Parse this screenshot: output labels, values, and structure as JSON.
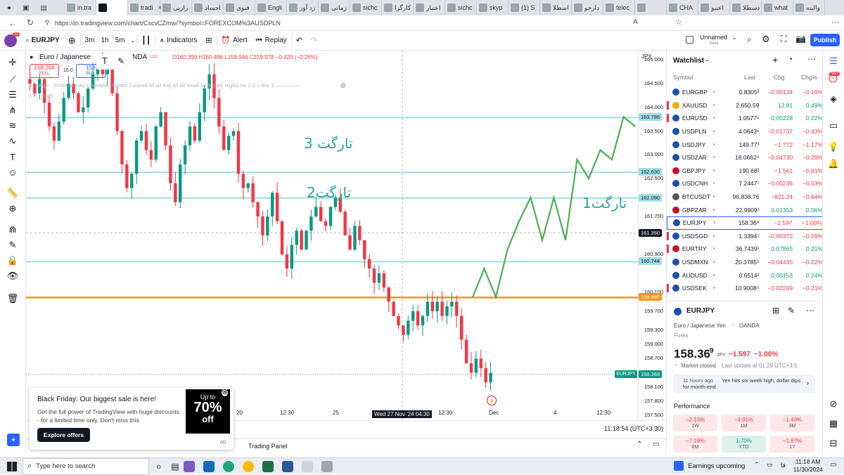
{
  "browser": {
    "tabs": [
      "in.tra",
      "",
      "tradi",
      "رازیی",
      "احساد",
      "قنوی",
      "Engli",
      "زد آوز",
      "زمانی",
      "sichc",
      "کارگزا",
      "اعتبار",
      "sichc",
      "skyp",
      "(1) S",
      "اسطلا",
      "دارجو",
      "telec",
      "",
      "CHA",
      "اعتبو",
      "دسطلا",
      "what",
      "والبنه"
    ],
    "active_tab": "",
    "url": "https://in.tradingview.com/chart/CscvCZmw/?symbol=FOREXCOM%3AUSDPLN",
    "profile_badge": "11"
  },
  "header": {
    "symbol": "EURJPY",
    "intervals": [
      "3m",
      "1h",
      "5m"
    ],
    "indicators_label": "Indicators",
    "alert_label": "Alert",
    "replay_label": "Replay",
    "layout_name": "Unnamed",
    "layout_status": "Save",
    "publish_label": "Publish"
  },
  "legend": {
    "title": "Euro / Japanese",
    "broker_tail": "NDA",
    "ohlc": "O160.399 H160.496 L159.946 C159.978 −0.420 (−0.26%)",
    "sell_price": "158.294",
    "sell_label": "SELL",
    "spread": "15.0",
    "buy_price": "158",
    "buy_label": "BUY",
    "indicator_line": "LuxAlgo - Smart Money Concepts Historic  Colored All All tiny All All small 50 5 5 Atr High/Low 3 0.1 tiny 1 —————",
    "indicator_line2": "CE 1 1.85"
  },
  "annotations": {
    "target3": "تارگت 3",
    "target2": "تارگت2",
    "target1": "تارگت1"
  },
  "price_axis": {
    "currency": "JPY",
    "ticks": [
      "165.000",
      "164.500",
      "164.000",
      "163.500",
      "163.000",
      "162.500",
      "161.700",
      "160.900",
      "160.100",
      "159.700",
      "159.300",
      "159.000",
      "158.700",
      "158.100",
      "157.800",
      "157.500"
    ],
    "tags": [
      {
        "text": "163.786",
        "kind": "level"
      },
      {
        "text": "162.630",
        "kind": "level"
      },
      {
        "text": "162.090",
        "kind": "level"
      },
      {
        "text": "161.350",
        "kind": "cursor"
      },
      {
        "text": "160.744",
        "kind": "level"
      },
      {
        "text": "159.990",
        "kind": "orange"
      },
      {
        "text": "158.369",
        "kind": "last"
      }
    ],
    "last_symbol_tag": "EURJPY"
  },
  "time_axis": {
    "labels": [
      "20",
      "12:30",
      "25",
      "12:30",
      "Dec",
      "4",
      "12:30"
    ],
    "cursor_label": "Wed 27 Nov '24  04:30",
    "clock": "11:18:54 (UTC+3:30)"
  },
  "bottom": {
    "trading_panel": "Trading Panel"
  },
  "promo": {
    "title": "Black Friday: Our biggest sale is here!",
    "body": "Get the full power of TradingView with huge discounts - for a limited time only. Don't miss this.",
    "button": "Explore offers",
    "badge_top": "Up to",
    "badge_big": "70%",
    "badge_bottom": "off",
    "ad": "AD"
  },
  "watchlist": {
    "title": "Watchlist",
    "columns": [
      "Symbol",
      "Last",
      "Chg",
      "Chg%"
    ],
    "rows": [
      {
        "sym": "EURGBP",
        "last": "0.8305²",
        "chg": "−0.00134",
        "chgp": "−0.16%",
        "dir": "neg",
        "flag": ""
      },
      {
        "sym": "XAUUSD",
        "last": "2,650.59",
        "chg": "12.81",
        "chgp": "0.49%",
        "dir": "pos",
        "flag": "#f23645"
      },
      {
        "sym": "EURUSD",
        "last": "1.0577⁸",
        "chg": "0.00228",
        "chgp": "0.22%",
        "dir": "pos",
        "flag": "#f23645"
      },
      {
        "sym": "USDPLN",
        "last": "4.0643⁶",
        "chg": "−0.01737",
        "chgp": "−0.43%",
        "dir": "neg",
        "flag": ""
      },
      {
        "sym": "USDJPY",
        "last": "149.77³",
        "chg": "−1.772",
        "chgp": "−1.17%",
        "dir": "neg",
        "flag": ""
      },
      {
        "sym": "USDZAR",
        "last": "18.0662⁴",
        "chg": "−0.04730",
        "chgp": "−0.26%",
        "dir": "neg",
        "flag": ""
      },
      {
        "sym": "GBPJPY",
        "last": "190.68²",
        "chg": "−1.561",
        "chgp": "−0.81%",
        "dir": "neg",
        "flag": ""
      },
      {
        "sym": "USDCNH",
        "last": "7.2447⁷",
        "chg": "−0.00236",
        "chgp": "−0.03%",
        "dir": "neg",
        "flag": ""
      },
      {
        "sym": "BTCUSDT",
        "last": "96,838.76",
        "chg": "−621.24",
        "chgp": "−0.64%",
        "dir": "neg",
        "flag": ""
      },
      {
        "sym": "GBPZAR",
        "last": "22.9909¹",
        "chg": "0.01353",
        "chgp": "0.06%",
        "dir": "pos",
        "flag": ""
      },
      {
        "sym": "EURJPY",
        "last": "158.36⁹",
        "chg": "−1.597",
        "chgp": "−1.00%",
        "dir": "neg",
        "flag": ""
      },
      {
        "sym": "USDSGD",
        "last": "1.3394⁷",
        "chg": "−0.00372",
        "chgp": "−0.28%",
        "dir": "neg",
        "flag": "#f23645"
      },
      {
        "sym": "EURTRY",
        "last": "36.7439¹",
        "chg": "0.07865",
        "chgp": "0.21%",
        "dir": "pos",
        "flag": "#f23645"
      },
      {
        "sym": "USDMXN",
        "last": "20.3785⁵",
        "chg": "−0.04435",
        "chgp": "−0.22%",
        "dir": "neg",
        "flag": ""
      },
      {
        "sym": "AUDUSD",
        "last": "0.6514²",
        "chg": "0.00153",
        "chgp": "0.24%",
        "dir": "pos",
        "flag": ""
      },
      {
        "sym": "USDSEK",
        "last": "10.9008⁴",
        "chg": "−0.02249",
        "chgp": "−0.21%",
        "dir": "neg",
        "flag": "#f23645"
      }
    ],
    "selected_index": 10
  },
  "details": {
    "symbol": "EURJPY",
    "name": "Euro / Japanese Yen",
    "exchange": "OANDA",
    "type": "Forex",
    "price": "158.36",
    "price_sup": "9",
    "currency": "JPY",
    "change": "−1.597",
    "change_pct": "−1.00%",
    "market_status": "Market closed",
    "last_update": "Last update at 01:29 UTC+3:5",
    "news_time": "11 hours ago",
    "news_text": "Yen hits six-week high, dollar dips for month-end",
    "performance_title": "Performance",
    "performance": [
      {
        "value": "−2.15%",
        "period": "1W",
        "dir": "r"
      },
      {
        "value": "−4.91%",
        "period": "1M",
        "dir": "r"
      },
      {
        "value": "−1.40%",
        "period": "3M",
        "dir": "r"
      },
      {
        "value": "−7.19%",
        "period": "6M",
        "dir": "r"
      },
      {
        "value": "1.70%",
        "period": "YTD",
        "dir": "g"
      },
      {
        "value": "−1.87%",
        "period": "1Y",
        "dir": "r"
      }
    ]
  },
  "notification_badge": "99+",
  "taskbar": {
    "search_placeholder": "Type here to search",
    "earnings": "Earnings upcoming",
    "time": "11:18 AM",
    "date": "11/30/2024",
    "lang": "فا"
  },
  "colors": {
    "up": "#089981",
    "down": "#f23645",
    "level_line": "#9fdde6",
    "orange_line": "#f7931a",
    "projection": "#4caf50",
    "annotation_text": "#26a69a",
    "accent": "#2962ff"
  },
  "chart_data": {
    "type": "candlestick",
    "symbol": "EURJPY",
    "ylim": [
      157.4,
      165.2
    ],
    "levels": [
      163.786,
      162.63,
      162.09,
      160.744,
      159.99
    ],
    "last_price": 158.369,
    "closes": [
      164.5,
      164.3,
      164.6,
      164.1,
      163.6,
      163.3,
      163.7,
      164.2,
      164.5,
      164.3,
      163.9,
      164.0,
      164.4,
      164.7,
      165.0,
      164.7,
      164.8,
      164.3,
      163.5,
      162.8,
      162.3,
      162.6,
      163.3,
      163.5,
      163.1,
      162.9,
      163.6,
      163.9,
      163.2,
      162.4,
      162.0,
      162.8,
      163.2,
      163.6,
      163.3,
      163.9,
      164.4,
      164.7,
      164.2,
      163.6,
      163.1,
      163.4,
      163.5,
      162.6,
      162.3,
      162.4,
      162.0,
      161.7,
      161.3,
      161.7,
      162.2,
      161.6,
      160.9,
      160.6,
      161.1,
      161.4,
      161.0,
      161.4,
      161.7,
      161.9,
      161.6,
      161.5,
      161.9,
      162.1,
      161.8,
      161.3,
      161.0,
      161.5,
      161.2,
      160.8,
      160.6,
      160.3,
      160.5,
      160.2,
      159.9,
      159.6,
      159.4,
      159.2,
      159.5,
      159.7,
      159.4,
      159.6,
      159.9,
      159.7,
      159.9,
      159.6,
      159.8,
      159.9,
      159.6,
      159.1,
      158.6,
      158.4,
      158.7,
      158.5,
      158.2,
      158.4
    ],
    "projection": [
      [
        159.99,
        160.6
      ],
      [
        160.0,
        161.0
      ],
      [
        161.6,
        162.1
      ],
      [
        161.2,
        162.1
      ],
      [
        161.2,
        162.9
      ],
      [
        162.5,
        163.1
      ],
      [
        162.9,
        163.8
      ],
      [
        163.6
      ]
    ]
  }
}
